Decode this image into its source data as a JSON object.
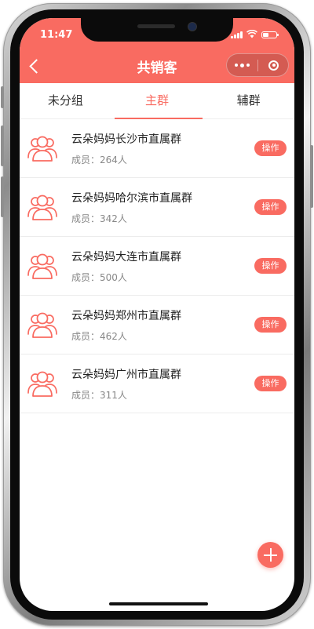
{
  "status_bar": {
    "time": "11:47"
  },
  "nav": {
    "title": "共销客"
  },
  "tabs": [
    {
      "label": "未分组",
      "active": false
    },
    {
      "label": "主群",
      "active": true
    },
    {
      "label": "辅群",
      "active": false
    }
  ],
  "groups": [
    {
      "name": "云朵妈妈长沙市直属群",
      "members": "成员：264人",
      "action_label": "操作"
    },
    {
      "name": "云朵妈妈哈尔滨市直属群",
      "members": "成员：342人",
      "action_label": "操作"
    },
    {
      "name": "云朵妈妈大连市直属群",
      "members": "成员：500人",
      "action_label": "操作"
    },
    {
      "name": "云朵妈妈郑州市直属群",
      "members": "成员：462人",
      "action_label": "操作"
    },
    {
      "name": "云朵妈妈广州市直属群",
      "members": "成员：311人",
      "action_label": "操作"
    }
  ],
  "icons": {
    "back": "chevron-left-icon",
    "more": "more-dots-icon",
    "close": "target-circle-icon",
    "group": "group-people-icon",
    "add": "plus-icon"
  },
  "colors": {
    "accent": "#f96b61",
    "frame": "#0b0b0b"
  }
}
